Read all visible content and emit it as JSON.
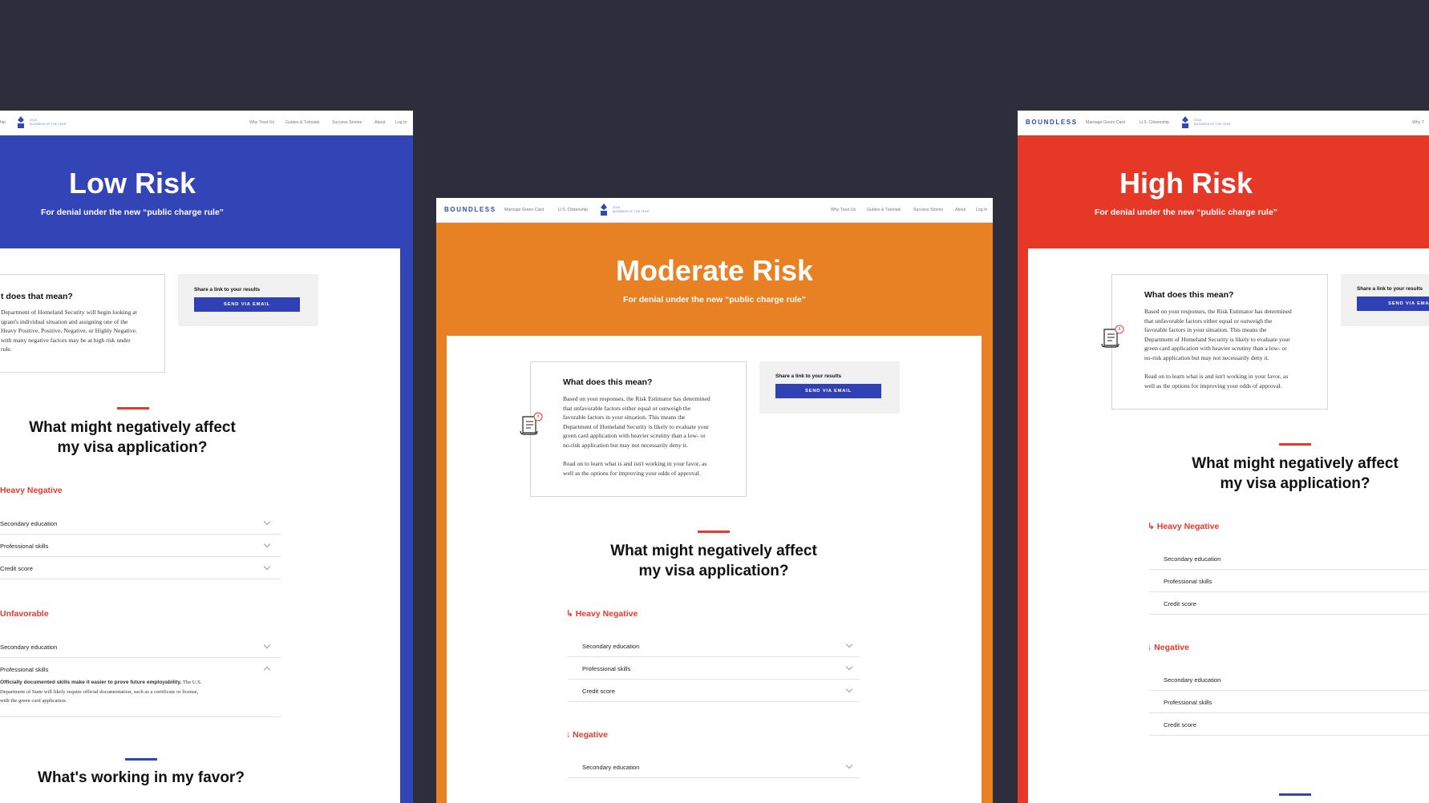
{
  "colors": {
    "background": "#2d2d3b",
    "low": "#3344b6",
    "moderate": "#e88123",
    "high": "#e63827",
    "accent_red": "#e8392a",
    "button": "#2f41b5"
  },
  "nav": {
    "brand": "BOUNDLESS",
    "links": [
      "Marriage Green Card",
      "U.S. Citizenship"
    ],
    "badge_year": "2018",
    "badge_text": "BUSINESS OF THE YEAR",
    "right_links": [
      "Why Trust Us",
      "Guides & Tutorials",
      "Success Stories",
      "About",
      "Log In"
    ],
    "left_fragment": "hip",
    "right_fragment": "Why T"
  },
  "share": {
    "label": "Share a link to your results",
    "button": "SEND VIA EMAIL",
    "button_cut": "SEND VIA EMAI"
  },
  "panels": {
    "low": {
      "title": "Low Risk",
      "subtitle": "For denial under the new “public charge rule”",
      "mean_title": "t does that mean?",
      "mean_lines": [
        "Department of Homeland Security will begin looking at",
        "igrant's individual situation and assigning one of the",
        "Heavy Positive, Positive, Negative, or Highly Negative.",
        "with many negative factors may be at high risk under",
        "rule."
      ],
      "question_l1": "What might negatively affect",
      "question_l2": "my visa application?",
      "cat1": "Heavy Negative",
      "cat1_rows": [
        "Secondary education",
        "Professional skills",
        "Credit score"
      ],
      "cat2": "Unfavorable",
      "cat2_rows": [
        "Secondary education",
        "Professional skills"
      ],
      "expl_bold": "Officially documented skills make it easier to prove future employability.",
      "expl_l1": " The U.S.",
      "expl_l2": "Department of State will likely require official documentation, such as a certificate or license,",
      "expl_l3": "with the green card application.",
      "favor": "What's working in my favor?"
    },
    "moderate": {
      "title": "Moderate Risk",
      "subtitle": "For denial under the new “public charge rule”",
      "mean_title": "What does this mean?",
      "mean_lines": [
        "Based on your responses, the Risk Estimator has determined",
        "that unfavorable factors either equal or outweigh the",
        "favorable factors in your situation. This means the",
        "Department of Homeland Security is likely to evaluate your",
        "green card application with heavier scrutiny than a low- or",
        "no-risk application but may not necessarily deny it.",
        "",
        "Read on to learn what is and isn't working in your favor, as",
        "well as the options for improving your odds of approval."
      ],
      "question_l1": "What might negatively affect",
      "question_l2": "my visa application?",
      "cat1": "Heavy Negative",
      "cat1_rows": [
        "Secondary education",
        "Professional skills",
        "Credit score"
      ],
      "cat2": "Negative",
      "cat2_rows": [
        "Secondary education"
      ]
    },
    "high": {
      "title": "High Risk",
      "subtitle": "For denial under the new “public charge rule”",
      "mean_title": "What does this mean?",
      "mean_lines": [
        "Based on your responses, the Risk Estimator has determined",
        "that unfavorable factors either equal or outweigh the",
        "favorable factors in your situation. This means the",
        "Department of Homeland Security is likely to evaluate your",
        "green card application with heavier scrutiny than a low- or",
        "no-risk application but may not necessarily deny it.",
        "",
        "Read on to learn what is and isn't working in your favor, as",
        "well as the options for improving your odds of approval."
      ],
      "question_l1": "What might negatively affect",
      "question_l2": "my visa application?",
      "cat1": "Heavy Negative",
      "cat1_rows": [
        "Secondary education",
        "Professional skills",
        "Credit score"
      ],
      "cat2": "Negative",
      "cat2_rows": [
        "Secondary education",
        "Professional skills",
        "Credit score"
      ]
    }
  }
}
